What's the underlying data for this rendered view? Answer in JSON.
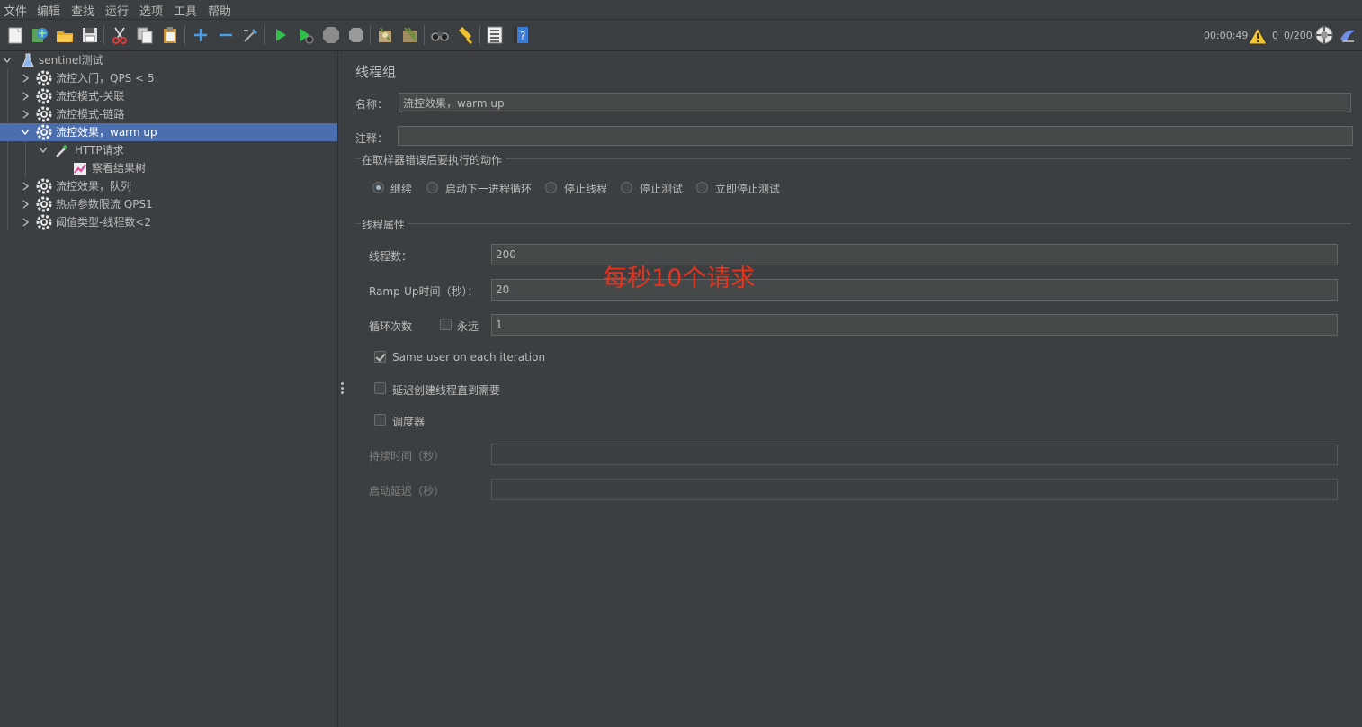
{
  "menu": [
    "文件",
    "编辑",
    "查找",
    "运行",
    "选项",
    "工具",
    "帮助"
  ],
  "status": {
    "elapsed": "00:00:49",
    "warnings": "0",
    "threads": "0/200"
  },
  "tree": {
    "root": "sentinel测试",
    "items": [
      {
        "label": "流控入门，QPS < 5"
      },
      {
        "label": "流控模式-关联"
      },
      {
        "label": "流控模式-链路"
      },
      {
        "label": "流控效果，warm up"
      },
      {
        "label": "HTTP请求"
      },
      {
        "label": "察看结果树"
      },
      {
        "label": "流控效果，队列"
      },
      {
        "label": "热点参数限流 QPS1"
      },
      {
        "label": "阈值类型-线程数<2"
      }
    ]
  },
  "panel": {
    "title": "线程组",
    "name_label": "名称：",
    "name_value": "流控效果，warm up",
    "comment_label": "注释：",
    "comment_value": "",
    "error_section": "在取样器错误后要执行的动作",
    "error_options": [
      "继续",
      "启动下一进程循环",
      "停止线程",
      "停止测试",
      "立即停止测试"
    ],
    "props_section": "线程属性",
    "threads_label": "线程数：",
    "threads_value": "200",
    "rampup_label": "Ramp-Up时间（秒）：",
    "rampup_value": "20",
    "loop_label": "循环次数",
    "forever_label": "永远",
    "loop_value": "1",
    "same_user_label": "Same user on each iteration",
    "delay_label": "延迟创建线程直到需要",
    "scheduler_label": "调度器",
    "duration_label": "持续时间（秒）",
    "duration_value": "",
    "startup_label": "启动延迟（秒）",
    "startup_value": "",
    "annotation": "每秒10个请求"
  }
}
